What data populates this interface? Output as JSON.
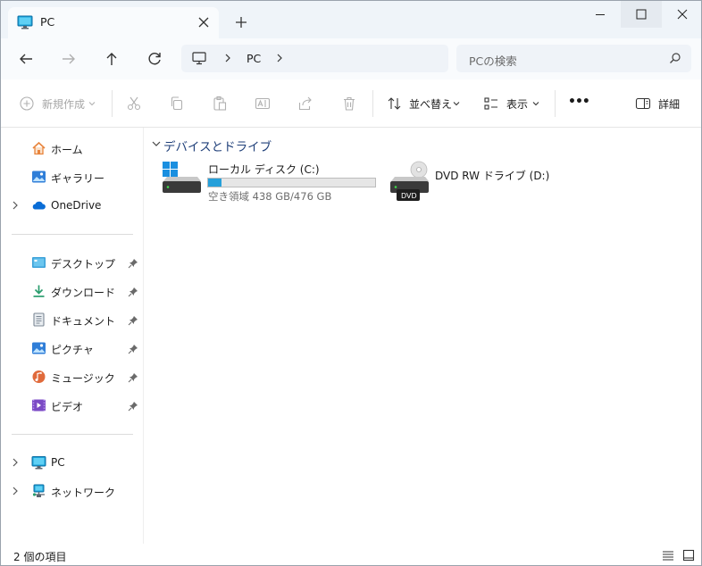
{
  "tab": {
    "title": "PC",
    "pc_icon": "monitor-icon",
    "close_icon": "close-icon"
  },
  "newtab_icon": "plus-icon",
  "window_controls": {
    "minimize_icon": "minimize-icon",
    "maximize_icon": "maximize-icon",
    "close_icon": "close-icon"
  },
  "nav": {
    "back_icon": "arrow-left-icon",
    "forward_icon": "arrow-right-icon",
    "up_icon": "arrow-up-icon",
    "refresh_icon": "refresh-icon"
  },
  "address": {
    "location": "PC"
  },
  "search": {
    "placeholder": "PCの検索"
  },
  "toolbar": {
    "new_label": "新規作成",
    "sort_label": "並べ替え",
    "view_label": "表示",
    "more_label": "•••",
    "details_label": "詳細"
  },
  "sidebar": {
    "items": [
      {
        "label": "ホーム",
        "icon": "home-icon",
        "color": "#e8843c"
      },
      {
        "label": "ギャラリー",
        "icon": "gallery-icon",
        "color": "#2f7ed8"
      },
      {
        "label": "OneDrive",
        "icon": "cloud-icon",
        "color": "#0a6dd6"
      }
    ],
    "quick": [
      {
        "label": "デスクトップ",
        "icon": "desktop-icon",
        "color": "#3aa0d8"
      },
      {
        "label": "ダウンロード",
        "icon": "download-icon",
        "color": "#2a9d6e"
      },
      {
        "label": "ドキュメント",
        "icon": "document-icon",
        "color": "#7b8794"
      },
      {
        "label": "ピクチャ",
        "icon": "picture-icon",
        "color": "#2f7ed8"
      },
      {
        "label": "ミュージック",
        "icon": "music-icon",
        "color": "#e06a3b"
      },
      {
        "label": "ビデオ",
        "icon": "video-icon",
        "color": "#7b4bc4"
      }
    ],
    "bottom": [
      {
        "label": "PC",
        "icon": "monitor-icon"
      },
      {
        "label": "ネットワーク",
        "icon": "network-icon"
      }
    ]
  },
  "content": {
    "group_title": "デバイスとドライブ",
    "drives": [
      {
        "name": "ローカル ディスク (C:)",
        "free_text": "空き領域 438 GB/476 GB",
        "used_fraction": 0.08,
        "icon": "windows-drive-icon"
      },
      {
        "name": "DVD RW ドライブ (D:)",
        "icon": "dvd-drive-icon",
        "badge": "DVD"
      }
    ]
  },
  "status": {
    "count_text": "2 個の項目"
  },
  "colors": {
    "accent": "#26a0da",
    "group_title": "#1f3f79"
  }
}
